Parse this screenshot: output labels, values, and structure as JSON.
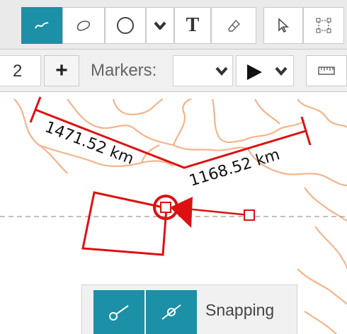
{
  "toolbar": {
    "tools": [
      {
        "name": "freehand-line-tool",
        "icon": "freehand-line-icon",
        "active": true
      },
      {
        "name": "freehand-polygon-tool",
        "icon": "freehand-polygon-icon",
        "active": false
      },
      {
        "name": "circle-tool",
        "icon": "circle-icon",
        "active": false
      },
      {
        "name": "shape-dropdown",
        "icon": "chevron-down-icon",
        "active": false
      },
      {
        "name": "text-tool",
        "icon": "text-icon",
        "active": false,
        "label": "T"
      },
      {
        "name": "eraser-tool",
        "icon": "eraser-icon",
        "active": false
      },
      {
        "name": "select-tool",
        "icon": "cursor-select-icon",
        "active": false
      },
      {
        "name": "transform-tool",
        "icon": "transform-box-icon",
        "active": false
      }
    ]
  },
  "options": {
    "step_value": "2",
    "plus_label": "+",
    "markers_label": "Markers:",
    "markers_selected": "",
    "arrow_icon": "arrow-right-icon",
    "ruler_icon": "ruler-icon"
  },
  "map": {
    "measurements": [
      {
        "label": "1471.52 km"
      },
      {
        "label": "1168.52 km"
      }
    ],
    "accent_color": "#dd1111",
    "border_color": "#f0a070"
  },
  "snapping": {
    "label": "Snapping",
    "buttons": [
      {
        "name": "snap-to-vertex",
        "icon": "snap-vertex-icon",
        "active": true
      },
      {
        "name": "snap-to-edge",
        "icon": "snap-edge-icon",
        "active": true
      }
    ],
    "active_color": "#1b90a7"
  }
}
